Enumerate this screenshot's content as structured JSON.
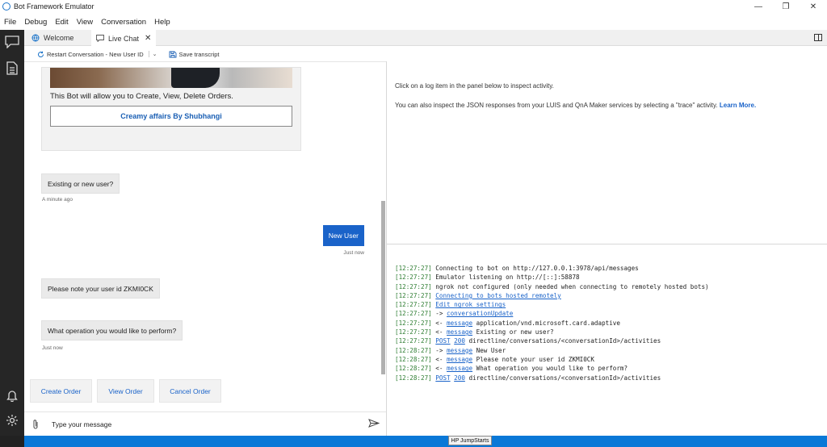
{
  "window": {
    "title": "Bot Framework Emulator",
    "controls": {
      "minimize": "—",
      "restore": "❐",
      "close": "✕"
    }
  },
  "menu": [
    "File",
    "Debug",
    "Edit",
    "View",
    "Conversation",
    "Help"
  ],
  "tabs": [
    {
      "label": "Welcome",
      "icon": "globe-icon"
    },
    {
      "label": "Live Chat",
      "icon": "chat-icon",
      "close": "✕",
      "active": true
    }
  ],
  "toolbar": {
    "restart_label": "Restart Conversation - New User ID",
    "restart_caret": "⌄",
    "save_label": "Save transcript"
  },
  "chat": {
    "hero_card": {
      "text": "This Bot will allow you to Create, View, Delete Orders.",
      "button_label": "Creamy affairs By Shubhangi"
    },
    "messages": [
      {
        "from": "bot",
        "text": "Existing or new user?",
        "timestamp": "A minute ago"
      },
      {
        "from": "user",
        "text": "New User",
        "timestamp": "Just now"
      },
      {
        "from": "bot",
        "text": "Please note your user id ZKMI0CK"
      },
      {
        "from": "bot",
        "text": "What operation you would like to perform?",
        "timestamp": "Just now"
      }
    ],
    "suggested_actions": [
      "Create Order",
      "View Order",
      "Cancel Order"
    ],
    "composer_placeholder": "Type your message"
  },
  "inspector": {
    "line1": "Click on a log item in the panel below to inspect activity.",
    "line2": "You can also inspect the JSON responses from your LUIS and QnA Maker services by selecting a \"trace\" activity.",
    "learn_more": "Learn More."
  },
  "log": [
    {
      "time": "[12:27:27]",
      "parts": [
        {
          "t": "Connecting to bot on http://127.0.0.1:3978/api/messages"
        }
      ]
    },
    {
      "time": "[12:27:27]",
      "parts": [
        {
          "t": "Emulator listening on http://[::]:58878"
        }
      ]
    },
    {
      "time": "[12:27:27]",
      "parts": [
        {
          "t": "ngrok not configured (only needed when connecting to remotely hosted bots)"
        }
      ]
    },
    {
      "time": "[12:27:27]",
      "parts": [
        {
          "t": "Connecting to bots hosted remotely",
          "link": true
        }
      ]
    },
    {
      "time": "[12:27:27]",
      "parts": [
        {
          "t": "Edit ngrok settings",
          "link": true
        }
      ]
    },
    {
      "time": "[12:27:27]",
      "parts": [
        {
          "t": "->"
        },
        {
          "t": "conversationUpdate",
          "link": true
        }
      ]
    },
    {
      "time": "[12:27:27]",
      "parts": [
        {
          "t": "<-"
        },
        {
          "t": "message",
          "link": true
        },
        {
          "t": "application/vnd.microsoft.card.adaptive"
        }
      ]
    },
    {
      "time": "[12:27:27]",
      "parts": [
        {
          "t": "<-"
        },
        {
          "t": "message",
          "link": true
        },
        {
          "t": "Existing or new user?"
        }
      ]
    },
    {
      "time": "[12:27:27]",
      "parts": [
        {
          "t": "POST",
          "link": true
        },
        {
          "t": "200",
          "link": true
        },
        {
          "t": "directline/conversations/<conversationId>/activities"
        }
      ]
    },
    {
      "time": "[12:28:27]",
      "parts": [
        {
          "t": "->"
        },
        {
          "t": "message",
          "link": true
        },
        {
          "t": "New User"
        }
      ]
    },
    {
      "time": "[12:28:27]",
      "parts": [
        {
          "t": "<-"
        },
        {
          "t": "message",
          "link": true
        },
        {
          "t": "Please note your user id ZKMI0CK"
        }
      ]
    },
    {
      "time": "[12:28:27]",
      "parts": [
        {
          "t": "<-"
        },
        {
          "t": "message",
          "link": true
        },
        {
          "t": "What operation you would like to perform?"
        }
      ]
    },
    {
      "time": "[12:28:27]",
      "parts": [
        {
          "t": "POST",
          "link": true
        },
        {
          "t": "200",
          "link": true
        },
        {
          "t": "directline/conversations/<conversationId>/activities"
        }
      ]
    }
  ],
  "taskbar": {
    "label": "HP JumpStarts"
  },
  "colors": {
    "accent": "#1a63c9",
    "sidebar": "#262626",
    "log_time": "#2e7d32",
    "taskbar": "#0a78d7"
  }
}
